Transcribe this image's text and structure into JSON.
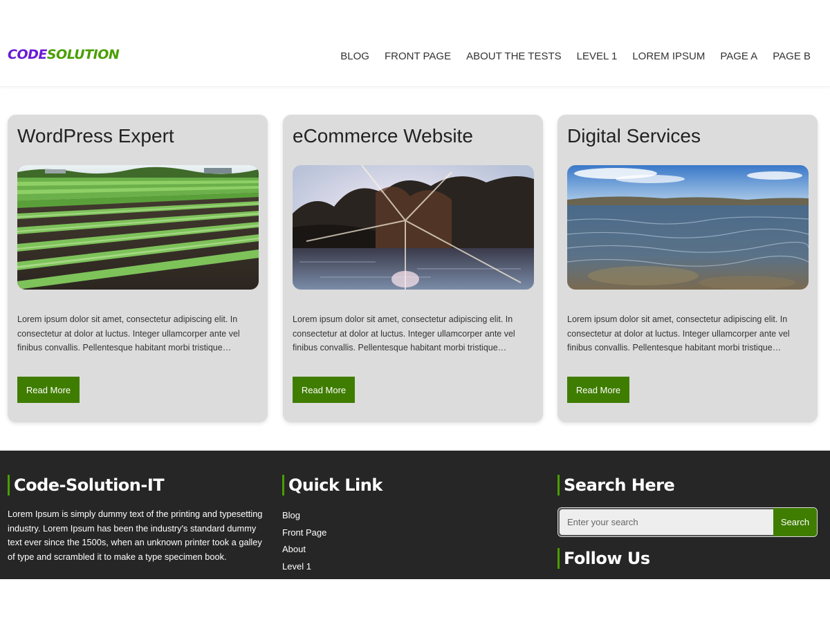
{
  "header": {
    "logo_part1": "CODE",
    "logo_part2": "SOLUTION",
    "nav": [
      {
        "label": "BLOG"
      },
      {
        "label": "FRONT PAGE"
      },
      {
        "label": "ABOUT THE TESTS"
      },
      {
        "label": "LEVEL 1"
      },
      {
        "label": "LOREM IPSUM"
      },
      {
        "label": "PAGE A"
      },
      {
        "label": "PAGE B"
      }
    ]
  },
  "cards": [
    {
      "title": "WordPress Expert",
      "image": "farm-field-photo",
      "text": "Lorem ipsum dolor sit amet, consectetur adipiscing elit. In consectetur at dolor at luctus. Integer ullamcorper ante vel finibus convallis. Pellentesque habitant morbi tristique senectus et netus et malesuada fames ac turpis egestas.",
      "button": "Read More"
    },
    {
      "title": "eCommerce Website",
      "image": "sunlit-lake-forest-photo",
      "text": "Lorem ipsum dolor sit amet, consectetur adipiscing elit. In consectetur at dolor at luctus. Integer ullamcorper ante vel finibus convallis. Pellentesque habitant morbi tristique senectus et netus et malesuada fames ac turpis egestas.",
      "button": "Read More"
    },
    {
      "title": "Digital Services",
      "image": "ocean-water-photo",
      "text": "Lorem ipsum dolor sit amet, consectetur adipiscing elit. In consectetur at dolor at luctus. Integer ullamcorper ante vel finibus convallis. Pellentesque habitant morbi tristique senectus et netus et malesuada fames ac turpis egestas.",
      "button": "Read More"
    }
  ],
  "footer": {
    "about": {
      "heading": "Code-Solution-IT",
      "text": "Lorem Ipsum is simply dummy text of the printing and typesetting industry. Lorem Ipsum has been the industry's standard dummy text ever since the 1500s, when an unknown printer took a galley of type and scrambled it to make a type specimen book."
    },
    "quick_links": {
      "heading": "Quick Link",
      "items": [
        "Blog",
        "Front Page",
        "About",
        "Level 1"
      ]
    },
    "search": {
      "heading": "Search Here",
      "placeholder": "Enter your search",
      "button": "Search"
    },
    "follow": {
      "heading": "Follow Us"
    }
  },
  "colors": {
    "accent_green": "#3f7d00",
    "logo_purple": "#6a1bd6",
    "logo_green": "#4a9e00",
    "footer_bg": "#262626",
    "card_bg": "#dcdcdc"
  }
}
